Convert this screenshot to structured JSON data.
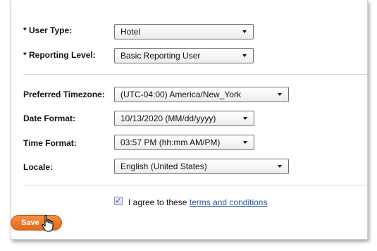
{
  "form": {
    "user_type": {
      "label": "* User Type:",
      "value": "Hotel"
    },
    "reporting_level": {
      "label": "* Reporting Level:",
      "value": "Basic Reporting User"
    },
    "timezone": {
      "label": "Preferred Timezone:",
      "value": "(UTC-04:00) America/New_York"
    },
    "date_format": {
      "label": "Date Format:",
      "value": "10/13/2020 (MM/dd/yyyy)"
    },
    "time_format": {
      "label": "Time Format:",
      "value": "03:57 PM (hh:mm AM/PM)"
    },
    "locale": {
      "label": "Locale:",
      "value": "English (United States)"
    }
  },
  "agreement": {
    "checked": true,
    "check_mark": "✓",
    "text": "I agree to these",
    "link_text": "terms and conditions"
  },
  "actions": {
    "save_label": "Save"
  },
  "icons": {
    "dropdown": "chevron-down-icon",
    "cursor": "hand-pointer-icon"
  },
  "colors": {
    "save_button": "#e8772a",
    "link": "#1e56a8"
  }
}
